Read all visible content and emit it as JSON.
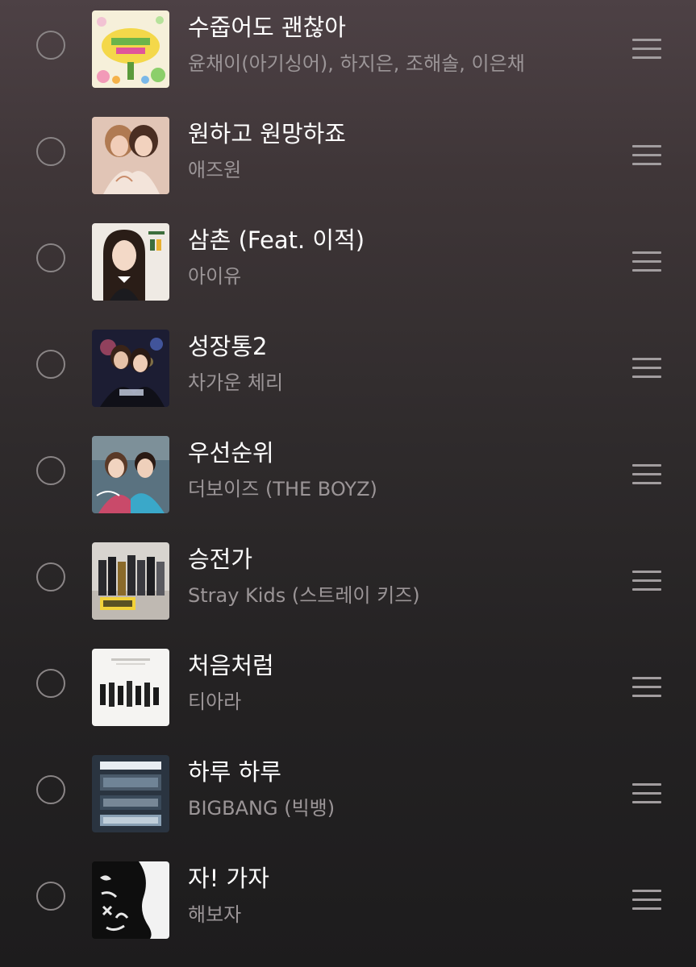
{
  "playlist": {
    "tracks": [
      {
        "title": "수줍어도 괜찮아",
        "artist": "윤채이(아기싱어), 하지은, 조해솔, 이은채",
        "art_icon": "album-art-icon"
      },
      {
        "title": "원하고 원망하죠",
        "artist": "애즈원",
        "art_icon": "album-art-icon"
      },
      {
        "title": "삼촌 (Feat. 이적)",
        "artist": "아이유",
        "art_icon": "album-art-icon"
      },
      {
        "title": "성장통2",
        "artist": "차가운 체리",
        "art_icon": "album-art-icon"
      },
      {
        "title": "우선순위",
        "artist": "더보이즈 (THE BOYZ)",
        "art_icon": "album-art-icon"
      },
      {
        "title": "승전가",
        "artist": "Stray Kids (스트레이 키즈)",
        "art_icon": "album-art-icon"
      },
      {
        "title": "처음처럼",
        "artist": "티아라",
        "art_icon": "album-art-icon"
      },
      {
        "title": "하루 하루",
        "artist": "BIGBANG (빅뱅)",
        "art_icon": "album-art-icon"
      },
      {
        "title": "자! 가자",
        "artist": "해보자",
        "art_icon": "album-art-icon"
      }
    ],
    "colors": {
      "title": "#ffffff",
      "artist": "#9b9597",
      "checkbox_border": "#8a8586",
      "handle": "#a29d9f"
    }
  }
}
